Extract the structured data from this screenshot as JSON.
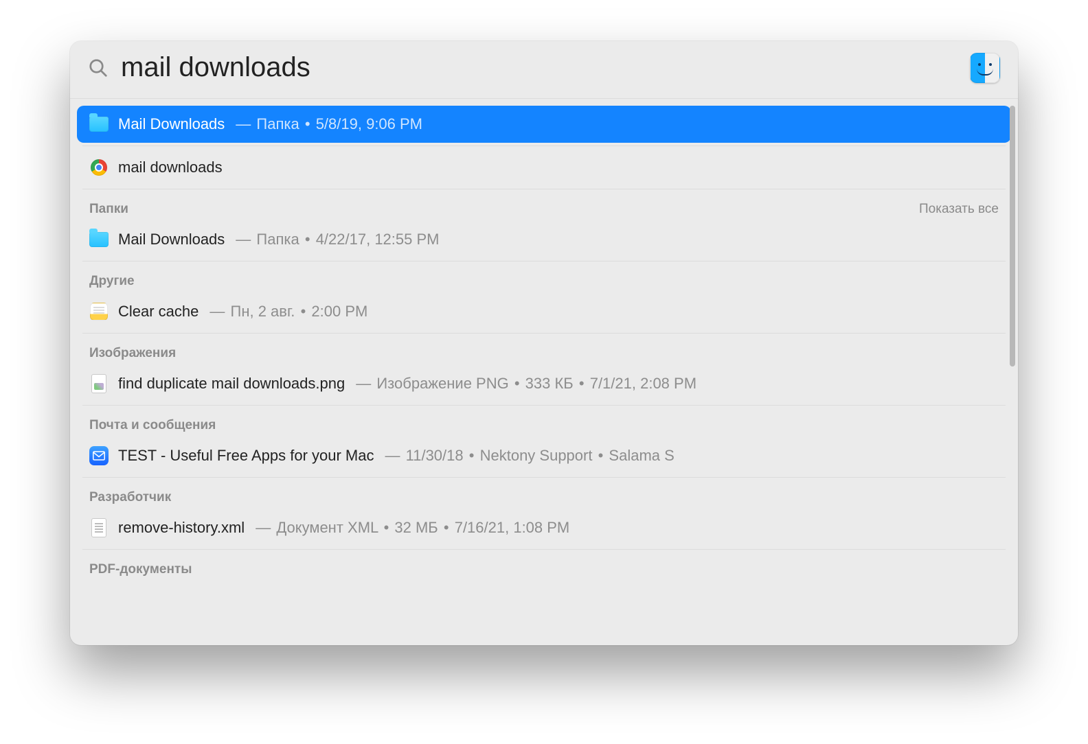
{
  "search": {
    "query": "mail downloads"
  },
  "topHit": {
    "title": "Mail Downloads",
    "kind": "Папка",
    "date": "5/8/19, 9:06 PM"
  },
  "webSuggestion": {
    "title": "mail downloads"
  },
  "sections": [
    {
      "label": "Папки",
      "showAll": "Показать все",
      "items": [
        {
          "icon": "folder",
          "title": "Mail Downloads",
          "meta": "Папка",
          "date": "4/22/17, 12:55 PM"
        }
      ]
    },
    {
      "label": "Другие",
      "items": [
        {
          "icon": "notes",
          "title": "Clear cache",
          "meta": "Пн, 2 авг.",
          "date": "2:00 PM"
        }
      ]
    },
    {
      "label": "Изображения",
      "items": [
        {
          "icon": "png",
          "title": "find duplicate mail downloads.png",
          "meta": "Изображение PNG",
          "size": "333 КБ",
          "date": "7/1/21, 2:08 PM"
        }
      ]
    },
    {
      "label": "Почта и сообщения",
      "items": [
        {
          "icon": "mail",
          "title": "TEST - Useful Free Apps for your Mac",
          "meta": "11/30/18",
          "from": "Nektony Support",
          "extra": "Salama S"
        }
      ]
    },
    {
      "label": "Разработчик",
      "items": [
        {
          "icon": "xml",
          "title": "remove-history.xml",
          "meta": "Документ XML",
          "size": "32 МБ",
          "date": "7/16/21, 1:08 PM"
        }
      ]
    },
    {
      "label": "PDF-документы",
      "items": []
    }
  ]
}
